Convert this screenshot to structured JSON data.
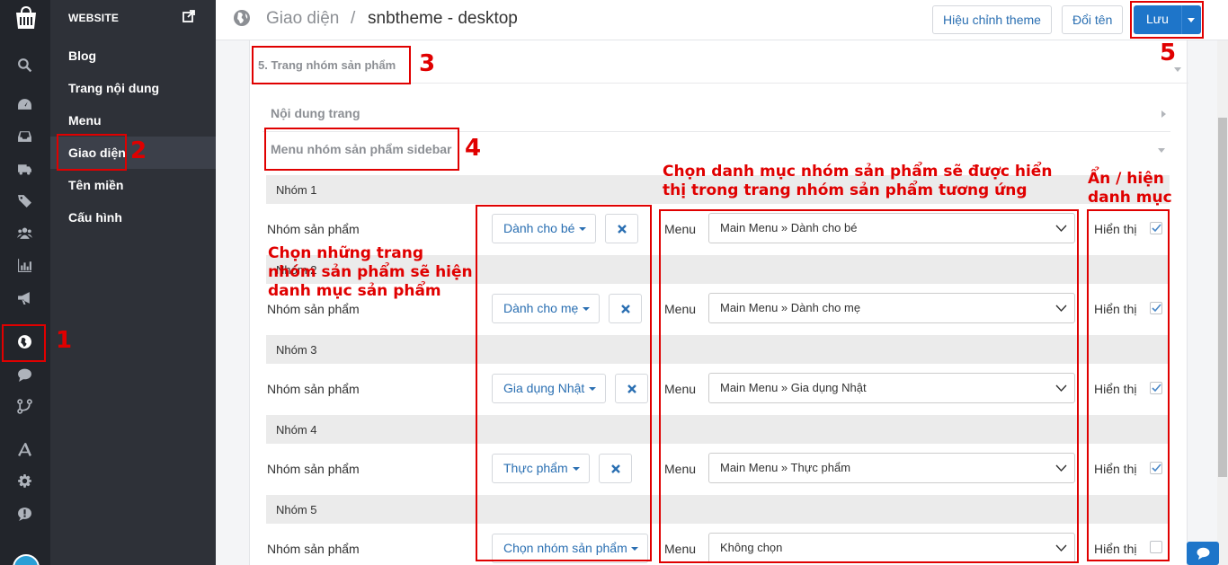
{
  "sidebar": {
    "header": "WEBSITE",
    "items": [
      {
        "label": "Blog"
      },
      {
        "label": "Trang nội dung"
      },
      {
        "label": "Menu"
      },
      {
        "label": "Giao diện"
      },
      {
        "label": "Tên miền"
      },
      {
        "label": "Cấu hình"
      }
    ]
  },
  "header": {
    "breadcrumb_root": "Giao diện",
    "breadcrumb_sep": "/",
    "breadcrumb_current": "snbtheme - desktop",
    "edit_theme_label": "Hiệu chỉnh theme",
    "rename_label": "Đổi tên",
    "save_label": "Lưu"
  },
  "section": {
    "title": "5. Trang nhóm sản phẩm",
    "sub1": "Nội dung trang",
    "sub2": "Menu nhóm sản phẩm sidebar"
  },
  "row_label": "Nhóm sản phẩm",
  "menu_label": "Menu",
  "show_label": "Hiển thị",
  "groups": [
    {
      "title": "Nhóm 1",
      "dropdown": "Dành cho bé",
      "menu": "Main Menu » Dành cho bé",
      "visible": true
    },
    {
      "title": "Nhóm 2",
      "dropdown": "Dành cho mẹ",
      "menu": "Main Menu » Dành cho mẹ",
      "visible": true
    },
    {
      "title": "Nhóm 3",
      "dropdown": "Gia dụng Nhật",
      "menu": "Main Menu » Gia dụng Nhật",
      "visible": true
    },
    {
      "title": "Nhóm 4",
      "dropdown": "Thực phẩm",
      "menu": "Main Menu » Thực phẩm",
      "visible": true
    },
    {
      "title": "Nhóm 5",
      "dropdown": "Chọn nhóm sản phẩm",
      "menu": "Không chọn",
      "visible": false
    }
  ],
  "annotations": {
    "n1": "1",
    "n2": "2",
    "n3": "3",
    "n4": "4",
    "n5": "5",
    "note_pages": "Chọn những trang nhóm sản phẩm sẽ hiện danh mục sản phẩm",
    "note_menu": "Chọn danh mục nhóm sản phẩm sẽ được hiển thị trong trang nhóm sản phẩm tương ứng",
    "note_toggle": "Ẩn / hiện danh mục"
  },
  "colors": {
    "accent": "#1e75c9",
    "annotation": "#e00000",
    "rail": "#22252b",
    "sidebar": "#2e3138"
  }
}
